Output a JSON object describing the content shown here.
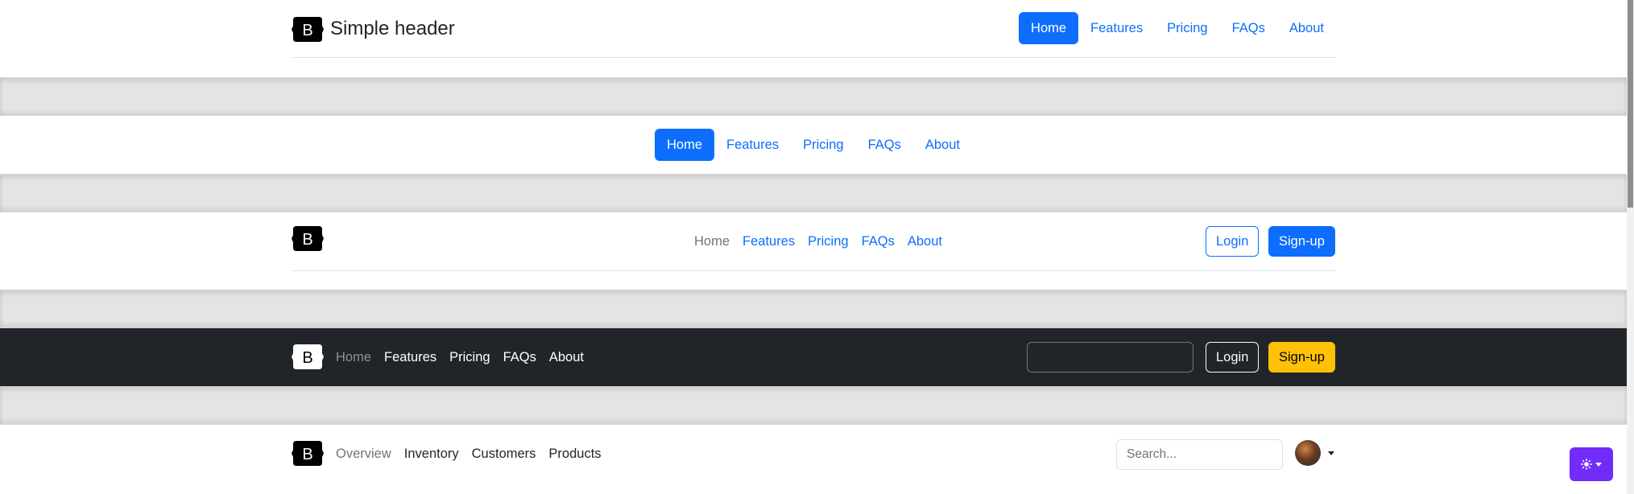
{
  "headers": {
    "simple": {
      "brand_text": "Simple header",
      "nav": [
        "Home",
        "Features",
        "Pricing",
        "FAQs",
        "About"
      ],
      "active": "Home"
    },
    "centered": {
      "nav": [
        "Home",
        "Features",
        "Pricing",
        "FAQs",
        "About"
      ],
      "active": "Home"
    },
    "with_buttons": {
      "nav": [
        "Home",
        "Features",
        "Pricing",
        "FAQs",
        "About"
      ],
      "login_label": "Login",
      "signup_label": "Sign-up"
    },
    "dark": {
      "nav": [
        "Home",
        "Features",
        "Pricing",
        "FAQs",
        "About"
      ],
      "search_value": "",
      "login_label": "Login",
      "signup_label": "Sign-up"
    },
    "dashboard": {
      "nav": [
        "Overview",
        "Inventory",
        "Customers",
        "Products"
      ],
      "search_placeholder": "Search..."
    }
  },
  "logo_letter": "B",
  "icons": {
    "brand": "bootstrap-logo-icon",
    "theme": "sun-icon",
    "profile": "avatar"
  },
  "colors": {
    "primary": "#0d6efd",
    "dark": "#212529",
    "warning": "#ffc107",
    "theme_toggle": "#712cf9",
    "divider": "#e4e4e4"
  }
}
